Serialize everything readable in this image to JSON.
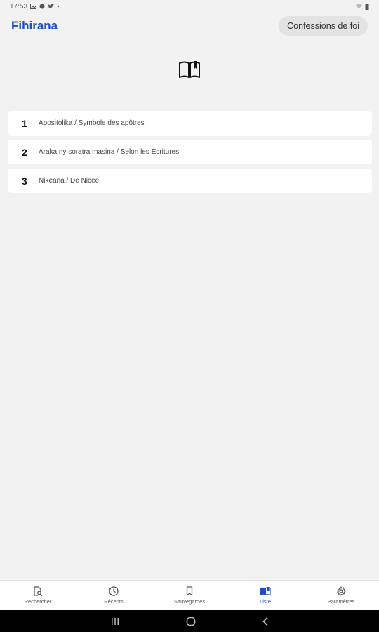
{
  "status_bar": {
    "time": "17:53",
    "left_icons": [
      "gallery-icon",
      "circle-icon",
      "twitter-icon",
      "dot-icon"
    ],
    "right_icons": [
      "wifi-icon",
      "battery-icon"
    ]
  },
  "header": {
    "title": "Fihirana",
    "chip_label": "Confessions de foi"
  },
  "hero_icon": "open-book-icon",
  "list": [
    {
      "num": "1",
      "label": "Apositolika / Symbole des apôtres"
    },
    {
      "num": "2",
      "label": "Araka ny soratra masina / Selon les Ecritures"
    },
    {
      "num": "3",
      "label": "Nikeana / De Nicee"
    }
  ],
  "bottom_nav": [
    {
      "label": "Rechercher",
      "icon": "search-document-icon",
      "active": false
    },
    {
      "label": "Récents",
      "icon": "clock-icon",
      "active": false
    },
    {
      "label": "Sauvegardés",
      "icon": "bookmark-icon",
      "active": false
    },
    {
      "label": "Liste",
      "icon": "book-list-icon",
      "active": true
    },
    {
      "label": "Paramètres",
      "icon": "gear-icon",
      "active": false
    }
  ],
  "colors": {
    "accent": "#1e4fc2",
    "background": "#f2f2f2"
  }
}
